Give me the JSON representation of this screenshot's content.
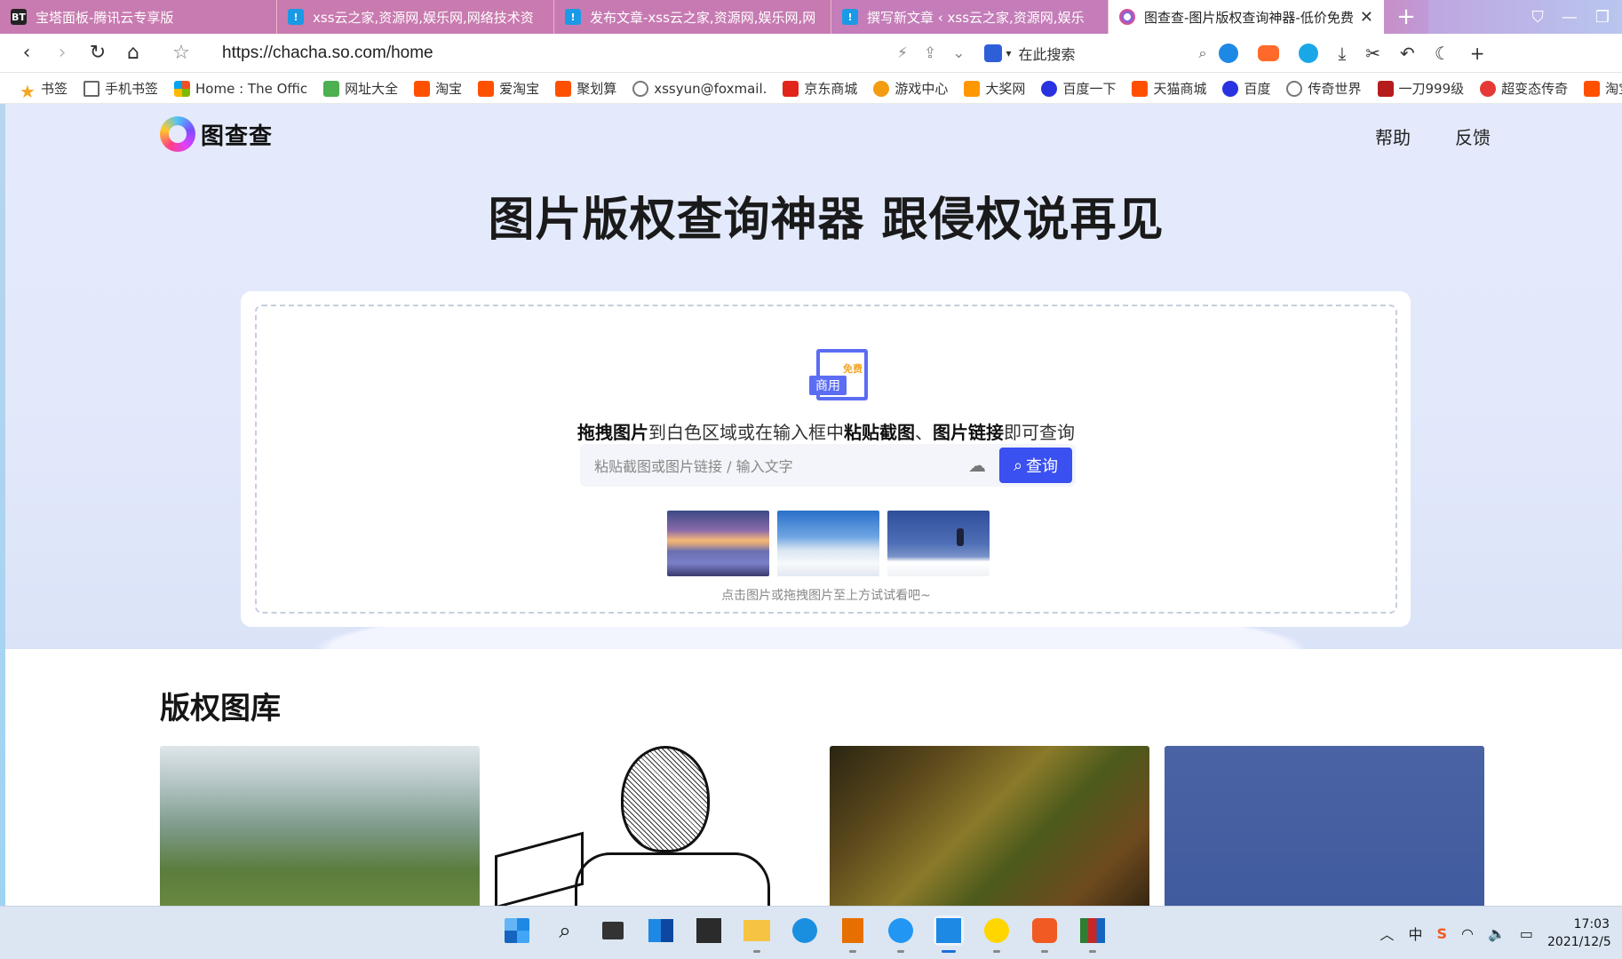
{
  "tabs": [
    {
      "favicon": "bt-icon",
      "title": "宝塔面板-腾讯云专享版"
    },
    {
      "favicon": "xss-icon",
      "title": "xss云之家,资源网,娱乐网,网络技术资"
    },
    {
      "favicon": "xss-icon",
      "title": "发布文章-xss云之家,资源网,娱乐网,网"
    },
    {
      "favicon": "xss-icon",
      "title": "撰写新文章 ‹ xss云之家,资源网,娱乐"
    },
    {
      "favicon": "chacha-icon",
      "title": "图查查-图片版权查询神器-低价免费",
      "active": true
    }
  ],
  "tab_controls": {
    "new_tab": "+",
    "close": "✕"
  },
  "address": {
    "url": "https://chacha.so.com/home",
    "search_placeholder": "在此搜索"
  },
  "bookmarks": [
    {
      "icon": "star-icon",
      "label": "书签"
    },
    {
      "icon": "phone-icon",
      "label": "手机书签"
    },
    {
      "icon": "microsoft-icon",
      "label": "Home : The Offic"
    },
    {
      "icon": "hao-icon",
      "label": "网址大全"
    },
    {
      "icon": "taobao-icon",
      "label": "淘宝"
    },
    {
      "icon": "taobao-icon",
      "label": "爱淘宝"
    },
    {
      "icon": "taobao-icon",
      "label": "聚划算"
    },
    {
      "icon": "globe-icon",
      "label": "xssyun@foxmail."
    },
    {
      "icon": "jd-icon",
      "label": "京东商城"
    },
    {
      "icon": "game-icon",
      "label": "游戏中心"
    },
    {
      "icon": "prize-icon",
      "label": "大奖网"
    },
    {
      "icon": "baidu-icon",
      "label": "百度一下"
    },
    {
      "icon": "taobao-icon",
      "label": "天猫商城"
    },
    {
      "icon": "baidu-icon",
      "label": "百度"
    },
    {
      "icon": "globe-icon",
      "label": "传奇世界"
    },
    {
      "icon": "cq-icon",
      "label": "一刀999级"
    },
    {
      "icon": "cb-icon",
      "label": "超变态传奇"
    },
    {
      "icon": "taobao-icon",
      "label": "淘宝"
    }
  ],
  "site": {
    "logo_text": "图查查",
    "nav": [
      "帮助",
      "反馈"
    ],
    "headline": "图片版权查询神器 跟侵权说再见",
    "upload_badge": {
      "free": "免费",
      "commercial": "商用"
    },
    "instruction": {
      "p1": "拖拽图片",
      "p2": "到白色区域或在输入框中",
      "p3": "粘贴截图",
      "p4": "、",
      "p5": "图片链接",
      "p6": "即可查询"
    },
    "search_placeholder": "粘贴截图或图片链接 / 输入文字",
    "query_button": "查询",
    "hint": "点击图片或拖拽图片至上方试试看吧~",
    "gallery_title": "版权图库"
  },
  "taskbar": {
    "apps": [
      "windows-start-icon",
      "search-icon",
      "task-view-icon",
      "widgets-icon",
      "store-icon",
      "file-explorer-icon",
      "edge-icon",
      "java-icon",
      "chat-icon",
      "browser-icon",
      "music-icon",
      "sogou-icon",
      "winrar-icon"
    ],
    "active_app": "browser-icon",
    "time": "17:03",
    "date": "2021/12/5"
  },
  "colors": {
    "accent": "#3a50f0",
    "hero_bg": "#e4eafc",
    "tab_bar": "#c87bb0"
  }
}
